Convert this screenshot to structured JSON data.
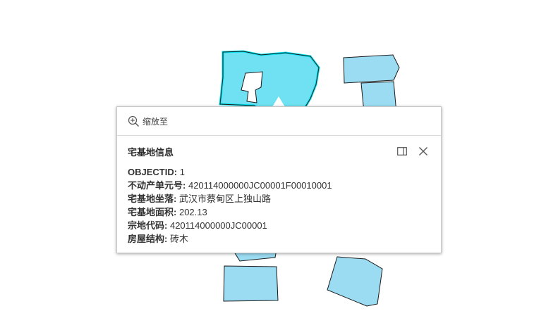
{
  "popup": {
    "zoom_action_label": "缩放至",
    "title": "宅基地信息",
    "icons": {
      "zoom": "zoom-in-icon",
      "dock": "dock-icon",
      "close": "close-icon"
    },
    "fields": [
      {
        "label": "OBJECTID:",
        "value": "1"
      },
      {
        "label": "不动产单元号:",
        "value": "420114000000JC00001F00010001"
      },
      {
        "label": "宅基地坐落:",
        "value": "武汉市蔡甸区上独山路"
      },
      {
        "label": "宅基地面积:",
        "value": "202.13"
      },
      {
        "label": "宗地代码:",
        "value": "420114000000JC00001"
      },
      {
        "label": "房屋结构:",
        "value": "砖木"
      }
    ]
  },
  "colors": {
    "parcel_fill": "#9bdcf2",
    "selected_fill": "#6fe1f2",
    "selected_outline": "#00e3f0",
    "outline": "#1b1b1b"
  }
}
